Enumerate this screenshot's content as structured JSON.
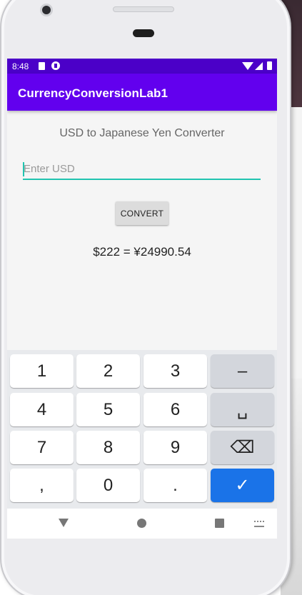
{
  "status_bar": {
    "time": "8:48"
  },
  "app_bar": {
    "title": "CurrencyConversionLab1"
  },
  "main": {
    "heading": "USD to Japanese Yen Converter",
    "input": {
      "placeholder": "Enter USD",
      "value": ""
    },
    "convert_label": "CONVERT",
    "result": "$222 = ¥24990.54"
  },
  "keyboard": {
    "rows": [
      [
        "1",
        "2",
        "3",
        "–"
      ],
      [
        "4",
        "5",
        "6",
        "␣"
      ],
      [
        "7",
        "8",
        "9",
        "⌫"
      ],
      [
        ",",
        "0",
        ".",
        "✓"
      ]
    ],
    "accent_color": "#1a73e8"
  },
  "colors": {
    "status_bar": "#4b00c8",
    "app_bar": "#6200ee",
    "input_underline": "#21c4b0"
  },
  "icons": {
    "nav_back": "back-triangle-icon",
    "nav_home": "home-circle-icon",
    "nav_recent": "recent-apps-square-icon",
    "nav_keyboard": "keyboard-switch-icon"
  }
}
